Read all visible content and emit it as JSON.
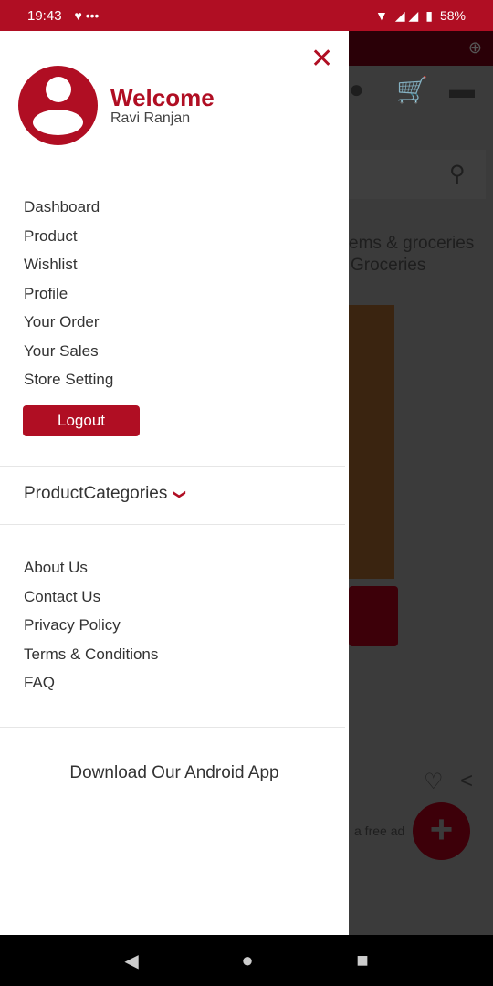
{
  "status_bar": {
    "time": "19:43",
    "battery": "58%"
  },
  "background": {
    "category_line1": "ems & groceries",
    "category_line2": "Groceries",
    "ad_text": "a free ad"
  },
  "drawer": {
    "welcome": "Welcome",
    "user_name": "Ravi Ranjan",
    "menu": [
      "Dashboard",
      "Product",
      "Wishlist",
      "Profile",
      "Your Order",
      "Your Sales",
      "Store Setting"
    ],
    "logout": "Logout",
    "categories": "ProductCategories",
    "info_links": [
      "About Us",
      "Contact Us",
      "Privacy Policy",
      "Terms & Conditions",
      "FAQ"
    ],
    "download": "Download Our Android App"
  },
  "colors": {
    "brand": "#b00e23"
  }
}
